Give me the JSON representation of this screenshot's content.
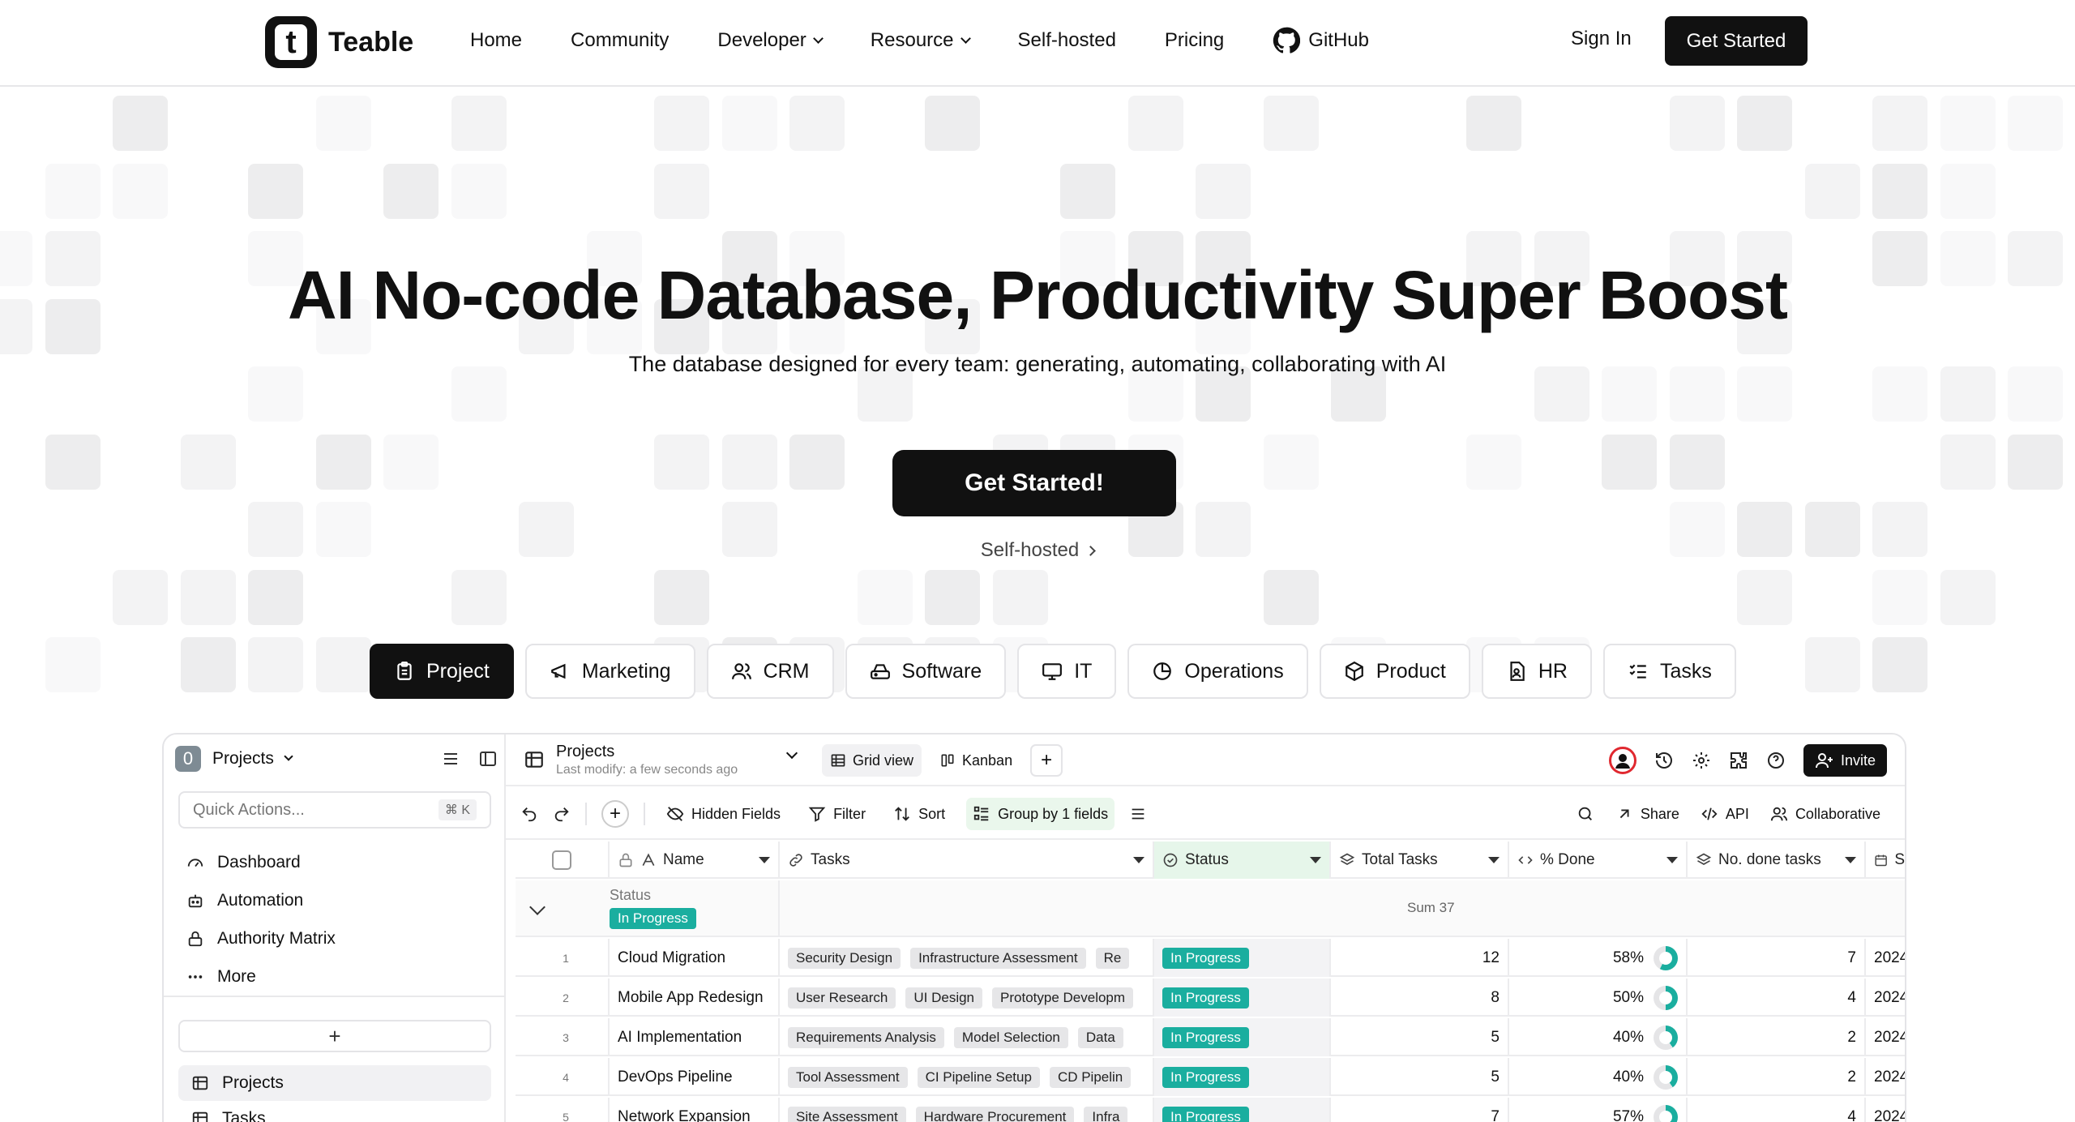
{
  "nav": {
    "brand": "Teable",
    "links": [
      {
        "label": "Home",
        "dropdown": false
      },
      {
        "label": "Community",
        "dropdown": false
      },
      {
        "label": "Developer",
        "dropdown": true
      },
      {
        "label": "Resource",
        "dropdown": true
      },
      {
        "label": "Self-hosted",
        "dropdown": false
      },
      {
        "label": "Pricing",
        "dropdown": false
      },
      {
        "label": "GitHub",
        "dropdown": false
      }
    ],
    "signin": "Sign In",
    "cta": "Get Started"
  },
  "hero": {
    "title": "AI No-code Database, Productivity Super Boost",
    "subtitle": "The database designed for every team: generating, automating, collaborating with AI",
    "cta": "Get Started!",
    "secondary": "Self-hosted"
  },
  "tabs": [
    {
      "label": "Project",
      "icon": "clipboard-icon",
      "active": true
    },
    {
      "label": "Marketing",
      "icon": "megaphone-icon",
      "active": false
    },
    {
      "label": "CRM",
      "icon": "users-icon",
      "active": false
    },
    {
      "label": "Software",
      "icon": "drive-icon",
      "active": false
    },
    {
      "label": "IT",
      "icon": "monitor-icon",
      "active": false
    },
    {
      "label": "Operations",
      "icon": "pie-icon",
      "active": false
    },
    {
      "label": "Product",
      "icon": "box-icon",
      "active": false
    },
    {
      "label": "HR",
      "icon": "file-user-icon",
      "active": false
    },
    {
      "label": "Tasks",
      "icon": "list-check-icon",
      "active": false
    }
  ],
  "app": {
    "space_badge": "0",
    "space_name": "Projects",
    "quick_placeholder": "Quick Actions...",
    "quick_kbd": "⌘ K",
    "menu": [
      {
        "label": "Dashboard",
        "icon": "gauge-icon"
      },
      {
        "label": "Automation",
        "icon": "bot-icon"
      },
      {
        "label": "Authority Matrix",
        "icon": "lock-icon"
      },
      {
        "label": "More",
        "icon": "dots-icon"
      }
    ],
    "add_label": "+",
    "tables": [
      {
        "label": "Projects",
        "active": true
      },
      {
        "label": "Tasks",
        "active": false
      }
    ],
    "table_title": "Projects",
    "table_modified": "Last modify: a few seconds ago",
    "views": [
      {
        "label": "Grid view",
        "active": true
      },
      {
        "label": "Kanban",
        "active": false
      }
    ],
    "invite": "Invite",
    "toolbar_left": [
      "Hidden Fields",
      "Filter",
      "Sort",
      "Group by 1 fields"
    ],
    "toolbar_right": [
      "Share",
      "API",
      "Collaborative"
    ],
    "columns": [
      "Name",
      "Tasks",
      "Status",
      "Total Tasks",
      "% Done",
      "No. done tasks",
      "S"
    ],
    "group": {
      "label": "Status",
      "value": "In Progress",
      "sum": "Sum 37"
    },
    "rows": [
      {
        "idx": "1",
        "name": "Cloud Migration",
        "tasks": [
          "Security Design",
          "Infrastructure Assessment",
          "Re"
        ],
        "status": "In Progress",
        "total": "12",
        "done_pct": "58%",
        "done_val": 58,
        "done_tasks": "7",
        "date": "2024"
      },
      {
        "idx": "2",
        "name": "Mobile App Redesign",
        "tasks": [
          "User Research",
          "UI Design",
          "Prototype Developm"
        ],
        "status": "In Progress",
        "total": "8",
        "done_pct": "50%",
        "done_val": 50,
        "done_tasks": "4",
        "date": "2024"
      },
      {
        "idx": "3",
        "name": "AI Implementation",
        "tasks": [
          "Requirements Analysis",
          "Model Selection",
          "Data"
        ],
        "status": "In Progress",
        "total": "5",
        "done_pct": "40%",
        "done_val": 40,
        "done_tasks": "2",
        "date": "2024"
      },
      {
        "idx": "4",
        "name": "DevOps Pipeline",
        "tasks": [
          "Tool Assessment",
          "CI Pipeline Setup",
          "CD Pipelin"
        ],
        "status": "In Progress",
        "total": "5",
        "done_pct": "40%",
        "done_val": 40,
        "done_tasks": "2",
        "date": "2024"
      },
      {
        "idx": "5",
        "name": "Network Expansion",
        "tasks": [
          "Site Assessment",
          "Hardware Procurement",
          "Infra"
        ],
        "status": "In Progress",
        "total": "7",
        "done_pct": "57%",
        "done_val": 57,
        "done_tasks": "4",
        "date": "2024"
      }
    ]
  },
  "colors": {
    "accent": "#111111",
    "status": "#1aae9f",
    "tile": "#f4f4f5"
  }
}
